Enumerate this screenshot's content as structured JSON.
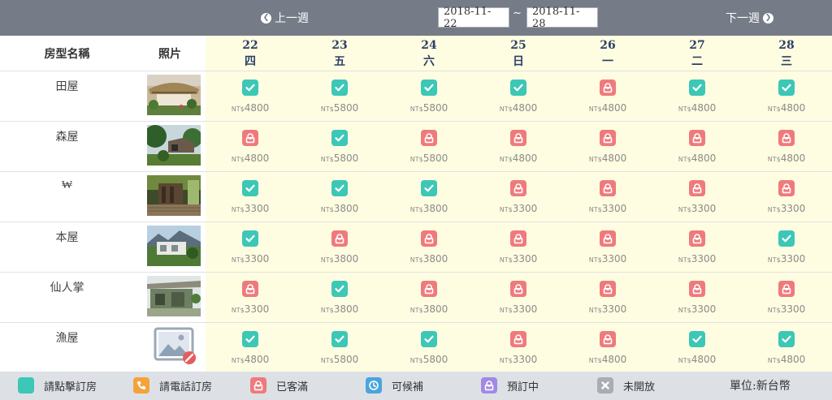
{
  "nav": {
    "prev_label": "上一週",
    "next_label": "下一週",
    "start_date": "2018-11-22",
    "end_date": "2018-11-28",
    "separator": "~"
  },
  "header": {
    "name_col": "房型名稱",
    "photo_col": "照片"
  },
  "days": [
    {
      "date": "22",
      "weekday": "四"
    },
    {
      "date": "23",
      "weekday": "五"
    },
    {
      "date": "24",
      "weekday": "六"
    },
    {
      "date": "25",
      "weekday": "日"
    },
    {
      "date": "26",
      "weekday": "一"
    },
    {
      "date": "27",
      "weekday": "二"
    },
    {
      "date": "28",
      "weekday": "三"
    }
  ],
  "currency": "NT$",
  "rooms": [
    {
      "name": "田屋",
      "photo": "thatched-hut",
      "cells": [
        {
          "status": "available",
          "price": "4800"
        },
        {
          "status": "available",
          "price": "5800"
        },
        {
          "status": "available",
          "price": "5800"
        },
        {
          "status": "available",
          "price": "4800"
        },
        {
          "status": "full",
          "price": "4800"
        },
        {
          "status": "available",
          "price": "4800"
        },
        {
          "status": "available",
          "price": "4800"
        }
      ]
    },
    {
      "name": "森屋",
      "photo": "forest-house",
      "cells": [
        {
          "status": "full",
          "price": "4800"
        },
        {
          "status": "available",
          "price": "5800"
        },
        {
          "status": "full",
          "price": "5800"
        },
        {
          "status": "full",
          "price": "4800"
        },
        {
          "status": "full",
          "price": "4800"
        },
        {
          "status": "full",
          "price": "4800"
        },
        {
          "status": "full",
          "price": "4800"
        }
      ]
    },
    {
      "name": "₩",
      "photo": "wood-deck",
      "cells": [
        {
          "status": "available",
          "price": "3300"
        },
        {
          "status": "available",
          "price": "3800"
        },
        {
          "status": "available",
          "price": "3800"
        },
        {
          "status": "full",
          "price": "3300"
        },
        {
          "status": "full",
          "price": "3300"
        },
        {
          "status": "full",
          "price": "3300"
        },
        {
          "status": "full",
          "price": "3300"
        }
      ]
    },
    {
      "name": "本屋",
      "photo": "main-house",
      "cells": [
        {
          "status": "available",
          "price": "3300"
        },
        {
          "status": "full",
          "price": "3800"
        },
        {
          "status": "full",
          "price": "3800"
        },
        {
          "status": "full",
          "price": "3300"
        },
        {
          "status": "full",
          "price": "3300"
        },
        {
          "status": "full",
          "price": "3300"
        },
        {
          "status": "available",
          "price": "3300"
        }
      ]
    },
    {
      "name": "仙人掌",
      "photo": "cactus-house",
      "cells": [
        {
          "status": "full",
          "price": "3300"
        },
        {
          "status": "available",
          "price": "3800"
        },
        {
          "status": "full",
          "price": "3800"
        },
        {
          "status": "full",
          "price": "3300"
        },
        {
          "status": "full",
          "price": "3300"
        },
        {
          "status": "full",
          "price": "3300"
        },
        {
          "status": "full",
          "price": "3300"
        }
      ]
    },
    {
      "name": "漁屋",
      "photo": "placeholder-image-icon",
      "cells": [
        {
          "status": "available",
          "price": "4800"
        },
        {
          "status": "available",
          "price": "5800"
        },
        {
          "status": "available",
          "price": "5800"
        },
        {
          "status": "full",
          "price": "3300"
        },
        {
          "status": "full",
          "price": "4800"
        },
        {
          "status": "available",
          "price": "4800"
        },
        {
          "status": "available",
          "price": "4800"
        }
      ]
    }
  ],
  "legend": {
    "items": [
      {
        "label": "請點擊訂房",
        "icon": "blank-square-icon",
        "color": "#3cc7b6"
      },
      {
        "label": "請電話訂房",
        "icon": "phone-icon",
        "color": "#f5a23a"
      },
      {
        "label": "已客滿",
        "icon": "lock-icon",
        "color": "#ef7a7c"
      },
      {
        "label": "可候補",
        "icon": "clock-icon",
        "color": "#4aa5dd"
      },
      {
        "label": "預訂中",
        "icon": "lock-icon",
        "color": "#a08ae4"
      },
      {
        "label": "未開放",
        "icon": "close-icon",
        "color": "#a9acb3"
      }
    ],
    "unit": "單位:新台幣"
  },
  "colors": {
    "topbar": "#757c87",
    "available": "#3cc7b6",
    "full": "#ef7a7c",
    "grid_bg": "#fffde1",
    "day_text": "#2d3f6a"
  }
}
